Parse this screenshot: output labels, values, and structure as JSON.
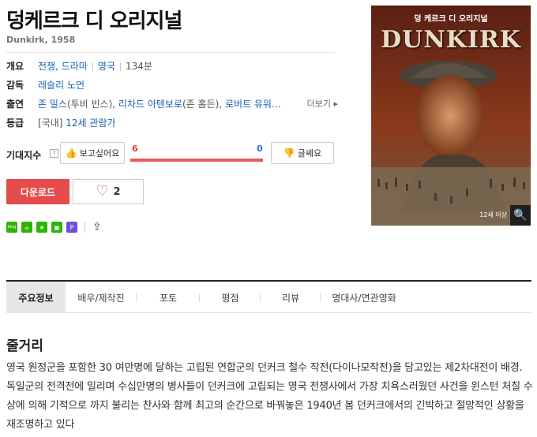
{
  "movie": {
    "title": "덩케르크 디 오리지널",
    "original_title": "Dunkirk, 1958"
  },
  "info": {
    "overview_label": "개요",
    "genres": "전쟁, 드라마",
    "country": "영국",
    "runtime": "134분",
    "director_label": "감독",
    "director": "레슬리 노먼",
    "cast_label": "출연",
    "cast": [
      {
        "name": "존 밀스",
        "role": "(투비 빈스), "
      },
      {
        "name": "리차드 아텐보로",
        "role": "(존 홈든), "
      },
      {
        "name": "로버트 유워…",
        "role": ""
      }
    ],
    "more_label": "더보기 ▸",
    "rating_label": "등급",
    "rating_prefix": "[국내]",
    "rating": "12세 관람가"
  },
  "expect": {
    "label": "기대지수",
    "help": "?",
    "want_label": "보고싶어요",
    "meh_label": "글쎄요",
    "want_count": "6",
    "meh_count": "0",
    "want_fraction": 1.0
  },
  "actions": {
    "download_label": "다운로드",
    "like_count": "2"
  },
  "share": {
    "blog_label": "blog",
    "icons": [
      "blog-icon",
      "cafe-icon",
      "star-icon",
      "band-icon",
      "post-icon",
      "share-icon"
    ]
  },
  "poster": {
    "caption_top": "덩 케르크 디 오리지널",
    "big_title": "DUNKIRK",
    "rating_badge": "12세 이상"
  },
  "tabs": [
    {
      "label": "주요정보",
      "active": true
    },
    {
      "label": "배우/제작진",
      "active": false
    },
    {
      "label": "포토",
      "active": false
    },
    {
      "label": "평점",
      "active": false
    },
    {
      "label": "리뷰",
      "active": false
    },
    {
      "label": "명대사/연관영화",
      "active": false
    }
  ],
  "synopsis": {
    "heading": "줄거리",
    "text": "영국 원정군을 포함한 30 여만명에 달하는 고립된 연합군의 던커크 철수 작전(다이나모작전)을 담고있는 제2차대전이 배경. 독일군의 전격전에 밀리며 수십만명의 병사들이 던커크에 고립되는 영국 전쟁사에서 가장 치욕스러웠던 사건을 윈스턴 처칠 수상에 의해 기적으로 까지 불리는 찬사와 함께 최고의 순간으로 바꿔놓은 1940년 봄 던커크에서의 긴박하고 절망적인 상황을 재조명하고 있다"
  },
  "colors": {
    "accent_red": "#e44b4b",
    "link_blue": "#1a5fb4",
    "naver_green": "#2db400"
  }
}
